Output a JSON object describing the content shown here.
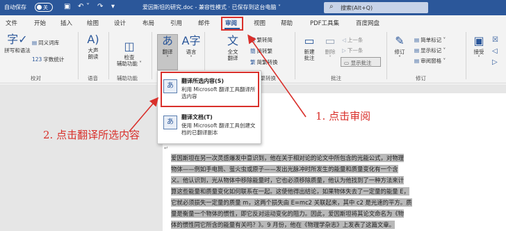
{
  "titlebar": {
    "autosave_label": "自动保存",
    "autosave_state": "关",
    "document_title": "爱因斯坦的研究.doc  -  兼容性模式 · 已保存到这台电脑 ˅",
    "search_placeholder": "搜索(Alt+Q)"
  },
  "tabs": [
    "文件",
    "开始",
    "插入",
    "绘图",
    "设计",
    "布局",
    "引用",
    "邮件",
    "审阅",
    "视图",
    "帮助",
    "PDF工具集",
    "百度网盘"
  ],
  "active_tab": "审阅",
  "ribbon": {
    "proofing": {
      "spelling": "拼写和语法",
      "thesaurus": "同义词库",
      "wordcount": "字数统计",
      "group": "校对"
    },
    "speech": {
      "read_aloud_line1": "大声",
      "read_aloud_line2": "朗读",
      "group": "语音"
    },
    "accessibility": {
      "check_line1": "检查",
      "check_line2": "辅助功能 ˅",
      "group": "辅助功能"
    },
    "language": {
      "translate": "翻译",
      "language": "语言"
    },
    "convert": {
      "full_label_line1": "全文",
      "full_label_line2": "翻译",
      "trad_to_simp": "繁转简",
      "simp_to_trad": "简转繁",
      "convert": "简繁转换",
      "group": "中文简繁转换"
    },
    "comments": {
      "new_line1": "新建",
      "new_line2": "批注",
      "delete": "删除",
      "previous": "上一条",
      "next": "下一条",
      "show_comments": "显示批注",
      "group": "批注"
    },
    "tracking": {
      "track": "修订",
      "simple_markup": "简单标记",
      "show_markup": "显示标记",
      "reviewing_pane": "审阅窗格",
      "group": "修订"
    },
    "changes": {
      "accept": "接受"
    }
  },
  "dropdown": {
    "translate_selection_title": "翻译所选内容(S)",
    "translate_selection_desc": "利用 Microsoft 翻译工具翻译所选内容",
    "translate_document_title": "翻译文档(T)",
    "translate_document_desc": "使用 Microsoft 翻译工具创建文档的已翻译副本"
  },
  "document": {
    "lines": [
      "爱因斯坦在另一次灵感爆发中意识到，他在关于相对论的论文中所包含的光能公式，对物理",
      "物体——例如手电筒、萤火虫或原子——发出光脉冲时所发生的能量和质量变化有一个含",
      "义。他认识到，光从物体中移除能量时，它也必须移除质量，他认为他找到了一种方法来计",
      "算这些能量和质量变化如何联系在一起。这使他得出结论，如果物体失去了一定量的能量 E，",
      "它就必须损失一定量的质量 m，这两个损失由 E=mc2 关联起来，其中 c2 是光速的平方。质",
      "量是衡量一个物体的惯性，即它反对运动变化的阻力。因此，爱因斯坦将其论文命名为《物",
      "体的惯性同它所含的能量有关吗？》。9 月份，他在《物理学杂志》上发表了这篇文章。"
    ]
  },
  "annotations": {
    "step1": "1. 点击审阅",
    "step2": "2. 点击翻译所选内容"
  },
  "colors": {
    "title_bar": "#2b579a",
    "highlight": "#d9302b",
    "ribbon_bg": "#f3f3f3"
  }
}
